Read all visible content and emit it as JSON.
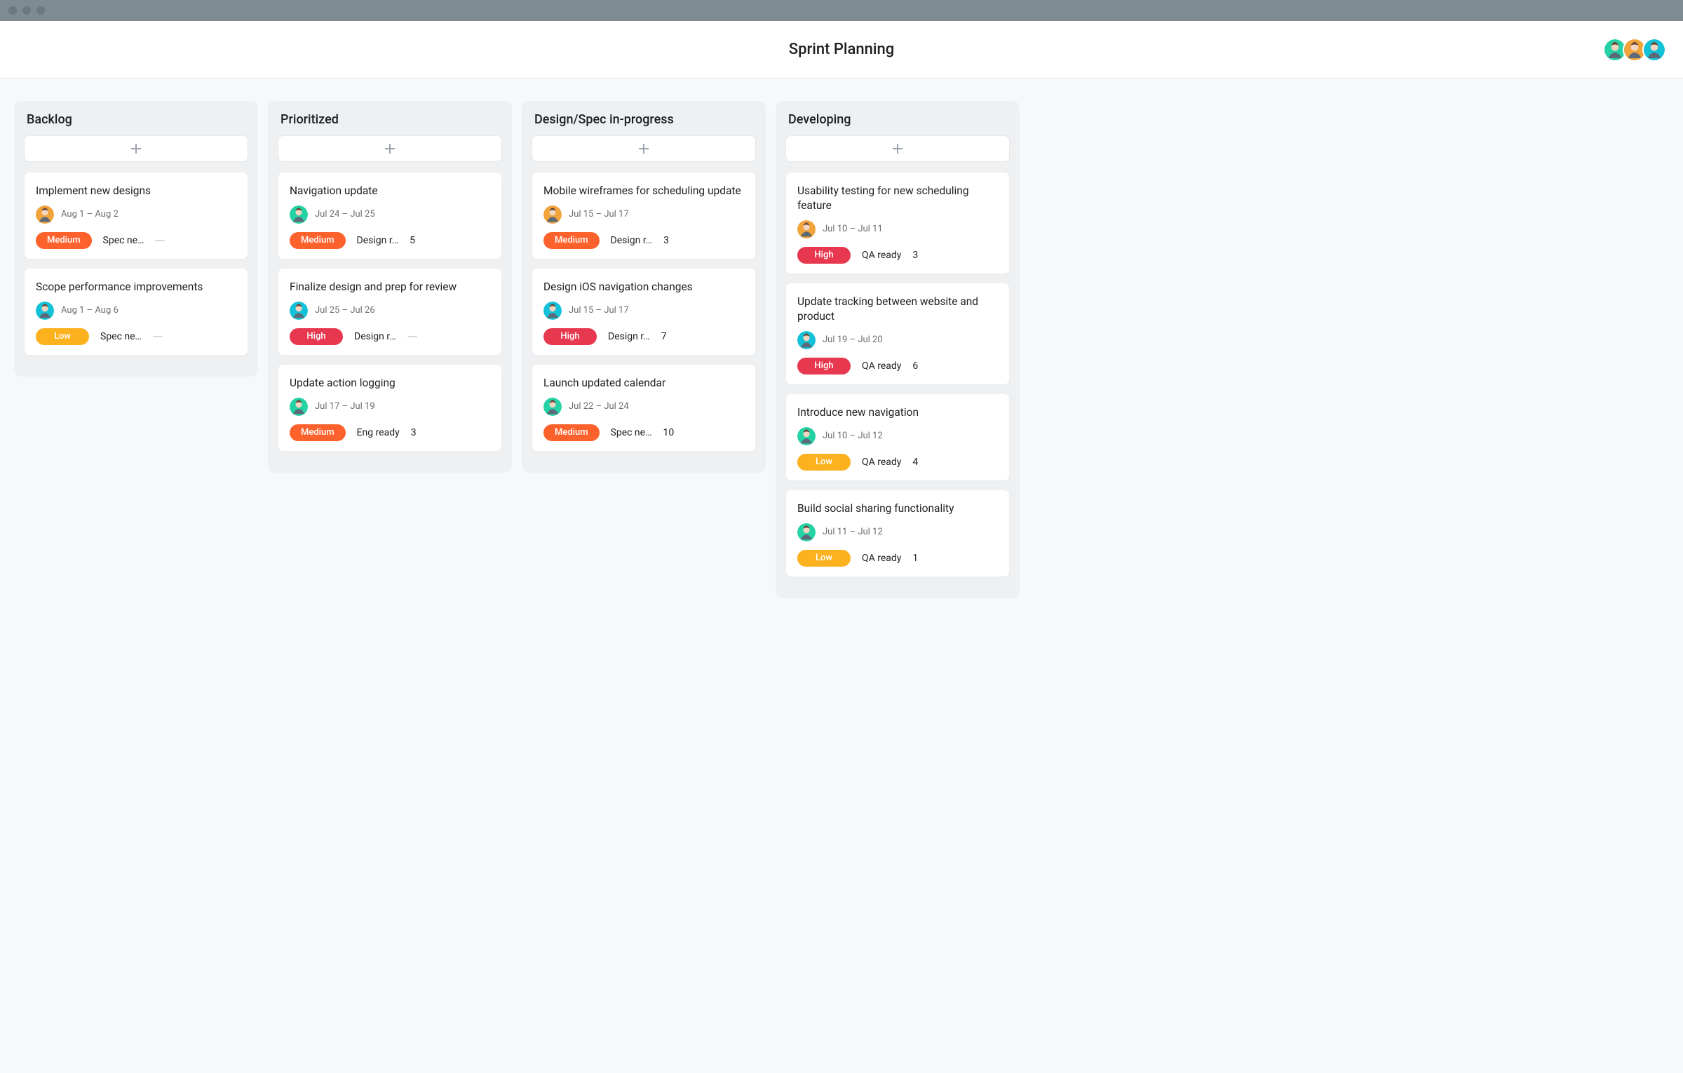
{
  "header": {
    "title": "Sprint Planning",
    "avatars": [
      "green",
      "orange",
      "teal"
    ]
  },
  "priorityColors": {
    "Medium": "#fd612c",
    "High": "#e8384f",
    "Low": "#fcb11e"
  },
  "avatarColors": {
    "green": "#24d2a6",
    "orange": "#f1a33c",
    "teal": "#13c2d8"
  },
  "columns": [
    {
      "title": "Backlog",
      "cards": [
        {
          "title": "Implement new designs",
          "avatar": "orange",
          "date": "Aug 1 – Aug 2",
          "priority": "Medium",
          "status": "Spec ne…",
          "count": null,
          "dash": true
        },
        {
          "title": "Scope performance improvements",
          "avatar": "teal",
          "date": "Aug 1 – Aug 6",
          "priority": "Low",
          "status": "Spec ne…",
          "count": null,
          "dash": true
        }
      ]
    },
    {
      "title": "Prioritized",
      "cards": [
        {
          "title": "Navigation update",
          "avatar": "green",
          "date": "Jul 24 – Jul 25",
          "priority": "Medium",
          "status": "Design r…",
          "count": 5,
          "dash": false
        },
        {
          "title": "Finalize design and prep for review",
          "avatar": "teal",
          "date": "Jul 25 – Jul 26",
          "priority": "High",
          "status": "Design r…",
          "count": null,
          "dash": true
        },
        {
          "title": "Update action logging",
          "avatar": "green",
          "date": "Jul 17 – Jul 19",
          "priority": "Medium",
          "status": "Eng ready",
          "count": 3,
          "dash": false
        }
      ]
    },
    {
      "title": "Design/Spec in-progress",
      "cards": [
        {
          "title": "Mobile wireframes for scheduling update",
          "avatar": "orange",
          "date": "Jul 15 – Jul 17",
          "priority": "Medium",
          "status": "Design r…",
          "count": 3,
          "dash": false
        },
        {
          "title": "Design iOS navigation changes",
          "avatar": "teal",
          "date": "Jul 15 – Jul 17",
          "priority": "High",
          "status": "Design r…",
          "count": 7,
          "dash": false
        },
        {
          "title": "Launch updated calendar",
          "avatar": "green",
          "date": "Jul 22 – Jul 24",
          "priority": "Medium",
          "status": "Spec ne…",
          "count": 10,
          "dash": false
        }
      ]
    },
    {
      "title": "Developing",
      "cards": [
        {
          "title": "Usability testing for new scheduling feature",
          "avatar": "orange",
          "date": "Jul 10 – Jul 11",
          "priority": "High",
          "status": "QA ready",
          "count": 3,
          "dash": false
        },
        {
          "title": "Update tracking between website and product",
          "avatar": "teal",
          "date": "Jul 19 – Jul 20",
          "priority": "High",
          "status": "QA ready",
          "count": 6,
          "dash": false
        },
        {
          "title": "Introduce new navigation",
          "avatar": "green",
          "date": "Jul 10 – Jul 12",
          "priority": "Low",
          "status": "QA ready",
          "count": 4,
          "dash": false
        },
        {
          "title": "Build social sharing functionality",
          "avatar": "green",
          "date": "Jul 11 – Jul 12",
          "priority": "Low",
          "status": "QA ready",
          "count": 1,
          "dash": false
        }
      ]
    }
  ]
}
